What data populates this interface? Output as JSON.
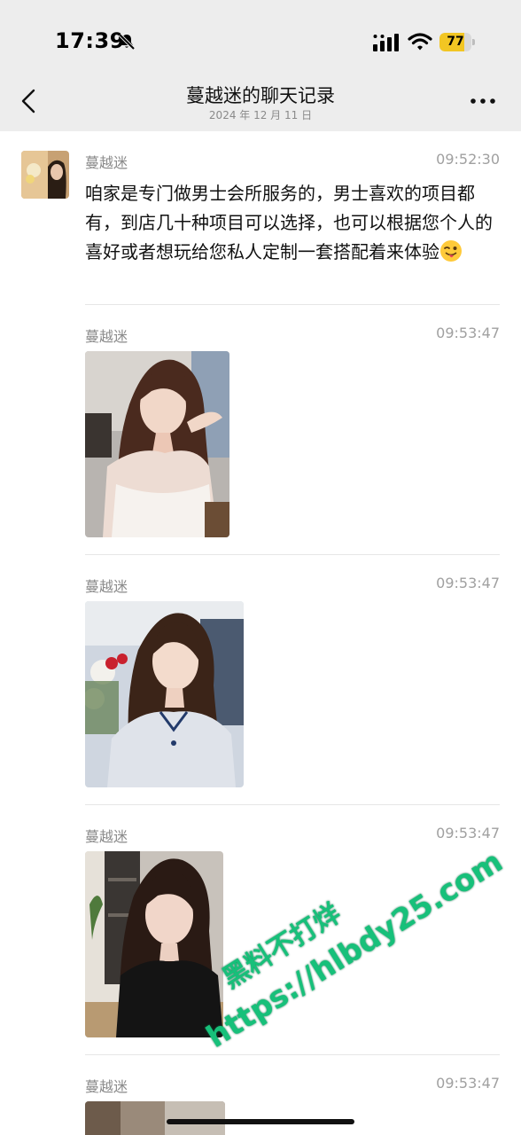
{
  "status_bar": {
    "time": "17:39",
    "battery_level": "77",
    "battery_fraction": 0.77,
    "icons": [
      "bell-slash-icon",
      "signal-icon",
      "wifi-icon",
      "battery-icon"
    ]
  },
  "nav": {
    "title": "蔓越迷的聊天记录",
    "subtitle": "2024 年 12 月 11 日",
    "back_icon": "chevron-left-icon",
    "more_icon": "more-icon"
  },
  "messages": [
    {
      "sender": "蔓越迷",
      "time": "09:52:30",
      "type": "text",
      "text": "咱家是专门做男士会所服务的，男士喜欢的项目都有，到店几十种项目可以选择，也可以根据您个人的喜好或者想玩给您私人定制一套搭配着来体验",
      "emoji": "winking-face-tongue-emoji"
    },
    {
      "sender": "蔓越迷",
      "time": "09:53:47",
      "type": "image",
      "image": "photo-woman-white-dress"
    },
    {
      "sender": "蔓越迷",
      "time": "09:53:47",
      "type": "image",
      "image": "photo-woman-qipao"
    },
    {
      "sender": "蔓越迷",
      "time": "09:53:47",
      "type": "image",
      "image": "photo-woman-black-cardigan"
    },
    {
      "sender": "蔓越迷",
      "time": "09:53:47",
      "type": "image",
      "image": "photo-partial"
    }
  ],
  "watermark": {
    "line1": "黑料不打烊",
    "line2": "https://hlbdy25.com"
  },
  "colors": {
    "header_bg": "#ededed",
    "watermark": "#17c07a",
    "battery": "#f2c623"
  }
}
